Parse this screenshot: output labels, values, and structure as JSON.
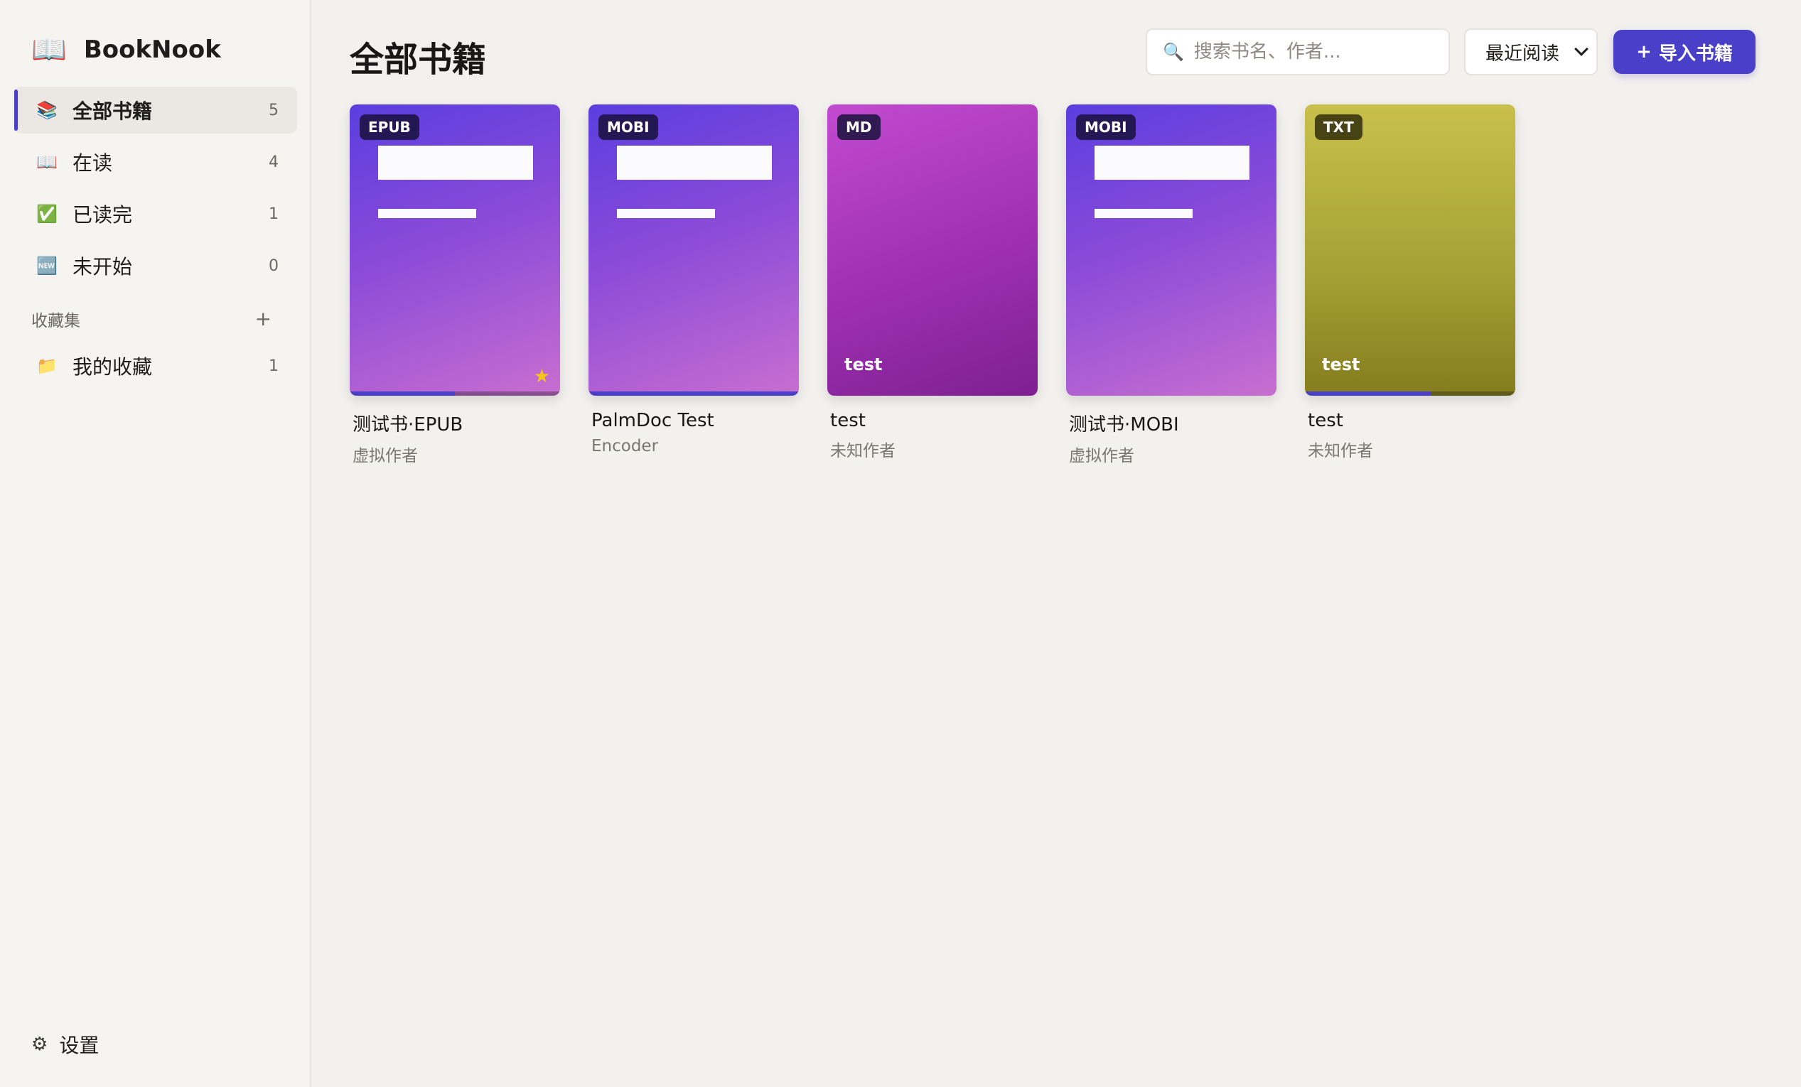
{
  "app": {
    "name": "BookNook",
    "icon": "open-book-icon"
  },
  "sidebar": {
    "items": [
      {
        "label": "全部书籍",
        "count": "5",
        "icon": "books-icon",
        "active": true
      },
      {
        "label": "在读",
        "count": "4",
        "icon": "open-book-icon"
      },
      {
        "label": "已读完",
        "count": "1",
        "icon": "check-box-icon"
      },
      {
        "label": "未开始",
        "count": "0",
        "icon": "new-badge-icon"
      }
    ],
    "collections_title": "收藏集",
    "collections_add": "+",
    "collections": [
      {
        "label": "我的收藏",
        "count": "1",
        "icon": "folder-icon"
      }
    ],
    "settings_label": "设置"
  },
  "header": {
    "title": "全部书籍",
    "search_placeholder": "搜索书名、作者...",
    "sort_value": "最近阅读",
    "import_label": "导入书籍",
    "import_plus": "+"
  },
  "books": [
    {
      "format": "EPUB",
      "title": "测试书·EPUB",
      "author": "虚拟作者",
      "cover_text": "",
      "favorite": true,
      "progress": 0.5,
      "theme": "purple",
      "colors": {
        "start": "#5a3ee0",
        "end": "#c86ed0"
      }
    },
    {
      "format": "MOBI",
      "title": "PalmDoc Test",
      "author": "Encoder",
      "cover_text": "",
      "favorite": false,
      "progress": 1.0,
      "theme": "purple",
      "colors": {
        "start": "#5a3ee0",
        "end": "#c86ed0"
      }
    },
    {
      "format": "MD",
      "title": "test",
      "author": "未知作者",
      "cover_text": "test",
      "favorite": false,
      "progress": 0,
      "theme": "magenta",
      "colors": {
        "start": "#c24ad0",
        "end": "#7e1f92"
      }
    },
    {
      "format": "MOBI",
      "title": "测试书·MOBI",
      "author": "虚拟作者",
      "cover_text": "",
      "favorite": false,
      "progress": 0,
      "theme": "purple",
      "colors": {
        "start": "#5a3ee0",
        "end": "#c86ed0"
      }
    },
    {
      "format": "TXT",
      "title": "test",
      "author": "未知作者",
      "cover_text": "test",
      "favorite": false,
      "progress": 0.6,
      "theme": "olive",
      "colors": {
        "start": "#c8c04a",
        "end": "#857d1e"
      }
    }
  ],
  "colors": {
    "accent": "#4a3fc8",
    "background": "#f3f1ee",
    "sidebar": "#f6f4f1"
  }
}
